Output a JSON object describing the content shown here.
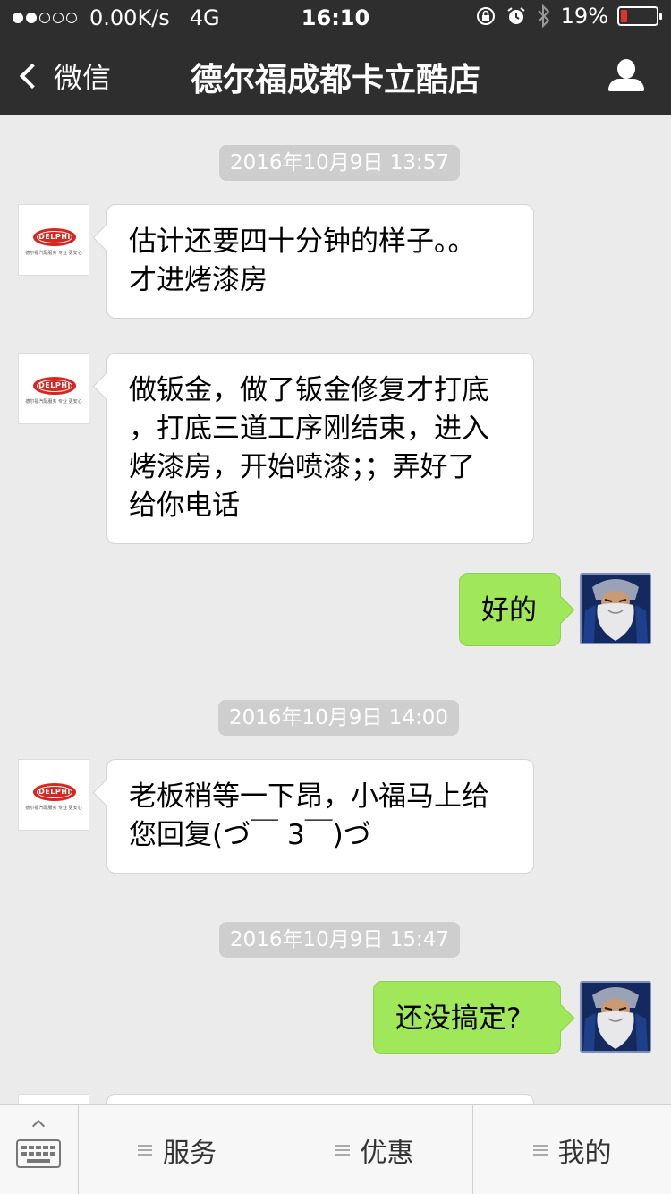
{
  "status_bar": {
    "network_speed": "0.00K/s",
    "network_type": "4G",
    "time": "16:10",
    "battery": "19%",
    "battery_level": 0.19,
    "signal_bars": 2
  },
  "nav": {
    "back_label": "微信",
    "title": "德尔福成都卡立酷店"
  },
  "brand": {
    "logo_text": "DELPHI",
    "logo_tagline": "德尔福汽配服务 专业 更安心"
  },
  "messages": [
    {
      "type": "timestamp",
      "text": "2016年10月9日 13:57"
    },
    {
      "type": "in",
      "lines": [
        "估计还要四十分钟的样子。。",
        "才进烤漆房"
      ]
    },
    {
      "type": "in",
      "lines": [
        "做钣金，做了钣金修复才打底",
        "，打底三道工序刚结束，进入",
        "烤漆房，开始喷漆；；弄好了",
        "给你电话"
      ]
    },
    {
      "type": "out",
      "lines": [
        "好的"
      ]
    },
    {
      "type": "timestamp",
      "text": "2016年10月9日 14:00"
    },
    {
      "type": "in",
      "lines": [
        "老板稍等一下昂，小福马上给",
        "您回复(づ￣ 3￣)づ"
      ]
    },
    {
      "type": "timestamp",
      "text": "2016年10月9日 15:47"
    },
    {
      "type": "out",
      "lines": [
        "还没搞定?"
      ]
    }
  ],
  "bottom_menu": {
    "items": [
      "服务",
      "优惠",
      "我的"
    ]
  },
  "colors": {
    "header_bg": "#2e2e2e",
    "chat_bg": "#ebebeb",
    "outgoing_bubble": "#a0e75a",
    "incoming_bubble": "#ffffff",
    "battery_low": "#e53030",
    "delphi_red": "#d7261f"
  }
}
